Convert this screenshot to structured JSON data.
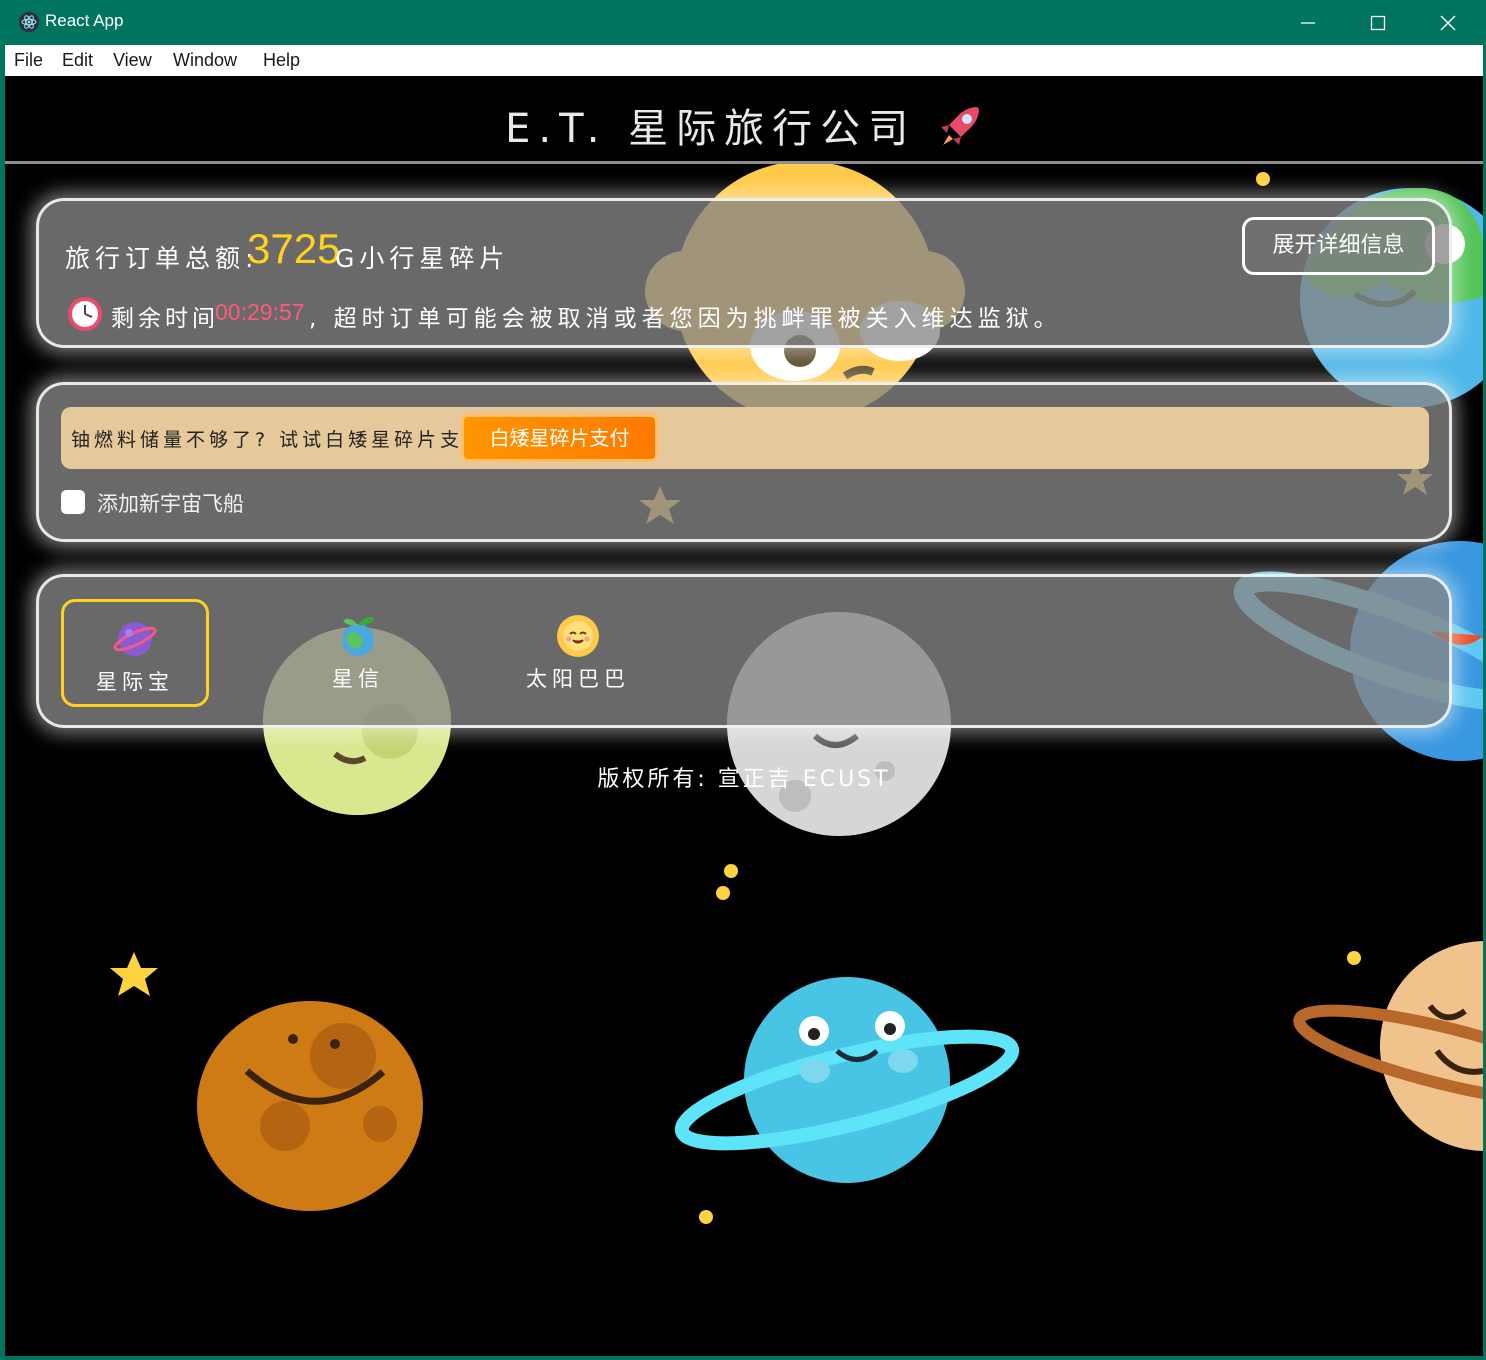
{
  "window": {
    "title": "React App",
    "controls": [
      "minimize-icon",
      "maximize-icon",
      "close-icon"
    ]
  },
  "menu": [
    "File",
    "Edit",
    "View",
    "Window",
    "Help"
  ],
  "header": {
    "title": "E.T. 星际旅行公司",
    "icon": "rocket-icon"
  },
  "order": {
    "total_label": "旅行订单总额:",
    "total_amount": "3725",
    "total_unit": "G小行星碎片",
    "remaining_label": "剩余时间",
    "remaining_time": "00:29:57",
    "warning": ", 超时订单可能会被取消或者您因为挑衅罪被关入维达监狱。",
    "detail_button": "展开详细信息"
  },
  "fuel": {
    "prompt": "铀燃料储量不够了? 试试白矮星碎片支付!",
    "pay_button": "白矮星碎片支付",
    "add_ship_label": "添加新宇宙飞船",
    "add_ship_checked": false
  },
  "payment_tabs": [
    {
      "label": "星际宝",
      "icon": "purple-planet-icon",
      "active": true
    },
    {
      "label": "星信",
      "icon": "earth-sprout-icon",
      "active": false
    },
    {
      "label": "太阳巴巴",
      "icon": "sun-face-icon",
      "active": false
    }
  ],
  "footer": {
    "copyright": "版权所有: 宣正吉 ECUST"
  },
  "colors": {
    "titlebar": "#00745f",
    "accent_yellow": "#ffd21f",
    "time_red": "#ff5a7a",
    "pay_orange": "#ff8a00",
    "fuel_bar": "#e5c99a"
  }
}
